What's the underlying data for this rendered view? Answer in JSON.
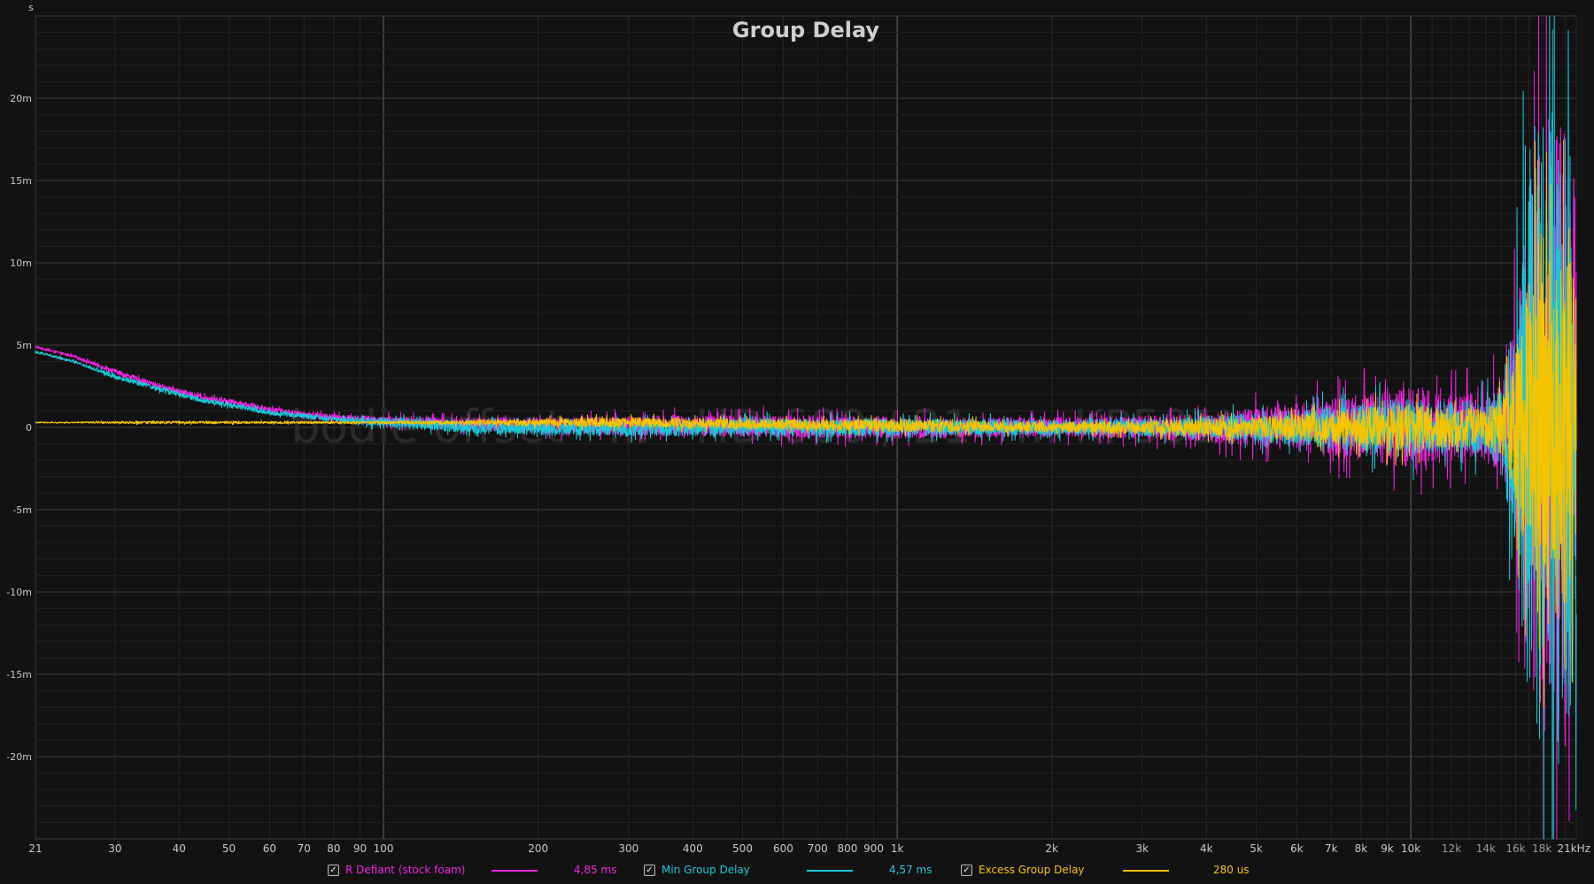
{
  "chart_data": {
    "type": "line",
    "title": "Group Delay",
    "ylabel": "s",
    "xlabel": "",
    "x_scale": "log",
    "xlim": [
      21,
      21000
    ],
    "ylim": [
      -0.025,
      0.025
    ],
    "grid": true,
    "legend_position": "bottom",
    "x_ticks_major": [
      "21",
      "30",
      "40",
      "50",
      "60",
      "70",
      "80",
      "90",
      "100",
      "200",
      "300",
      "400",
      "500",
      "600",
      "700",
      "800",
      "900",
      "1k",
      "2k",
      "3k",
      "4k",
      "5k",
      "6k",
      "7k",
      "8k",
      "9k",
      "10k",
      "21kHz"
    ],
    "x_ticks_minor": [
      "12k",
      "14k",
      "16k",
      "18k"
    ],
    "y_ticks": [
      "20m",
      "15m",
      "10m",
      "5m",
      "0",
      "-5m",
      "-10m",
      "-15m",
      "-20m"
    ],
    "watermark": "bodie offset · ... · HD 600 / 21 · ... KP501X · ...",
    "series": [
      {
        "name": "R Defiant (stock foam)",
        "color": "#ee22dd",
        "legend_value": "4,85 ms",
        "x": [
          21,
          25,
          30,
          35,
          40,
          45,
          50,
          60,
          70,
          80,
          90,
          100,
          150,
          200,
          300,
          500,
          1000,
          2000,
          3000,
          4000,
          5000,
          6000,
          7000,
          8000,
          9000,
          10000,
          12000,
          14000,
          15000,
          16000,
          17000,
          18000,
          19000,
          20000,
          21000
        ],
        "y": [
          0.0049,
          0.0043,
          0.0034,
          0.0027,
          0.0022,
          0.0018,
          0.0016,
          0.0011,
          0.0008,
          0.0006,
          0.0005,
          0.0004,
          0.0002,
          0.0001,
          0.0001,
          0.0001,
          0.0,
          0.0,
          0.0,
          0.0,
          0.0,
          0.0,
          0.0,
          0.0,
          0.0,
          0.0,
          0.0,
          0.0,
          0.0,
          0.0,
          0.0,
          0.0,
          0.0,
          0.0,
          0.0
        ],
        "spread": [
          0.0001,
          0.0001,
          0.0002,
          0.0002,
          0.0002,
          0.0002,
          0.0002,
          0.0002,
          0.0002,
          0.0003,
          0.0003,
          0.0004,
          0.0005,
          0.0006,
          0.0008,
          0.0009,
          0.0009,
          0.0008,
          0.0009,
          0.0012,
          0.0016,
          0.0019,
          0.0023,
          0.0027,
          0.003,
          0.0034,
          0.0028,
          0.0028,
          0.004,
          0.009,
          0.02,
          0.026,
          0.026,
          0.024,
          0.02
        ]
      },
      {
        "name": "Min Group Delay",
        "color": "#17c9d6",
        "legend_value": "4,57 ms",
        "x": [
          21,
          25,
          30,
          35,
          40,
          45,
          50,
          60,
          70,
          80,
          90,
          100,
          150,
          200,
          300,
          500,
          1000,
          2000,
          3000,
          4000,
          5000,
          6000,
          7000,
          8000,
          9000,
          10000,
          12000,
          14000,
          15000,
          16000,
          17000,
          18000,
          19000,
          20000,
          21000
        ],
        "y": [
          0.0046,
          0.004,
          0.0031,
          0.0025,
          0.002,
          0.0016,
          0.0014,
          0.0009,
          0.0007,
          0.0005,
          0.0004,
          0.0003,
          0.0,
          -0.0001,
          -0.0001,
          0.0,
          0.0,
          0.0,
          0.0,
          0.0,
          0.0,
          0.0,
          0.0,
          0.0,
          0.0,
          0.0,
          0.0,
          0.0,
          0.0,
          0.0,
          0.0,
          0.0,
          0.0,
          0.0,
          0.0
        ],
        "spread": [
          0.0001,
          0.0001,
          0.0002,
          0.0002,
          0.0002,
          0.0002,
          0.0002,
          0.0002,
          0.0002,
          0.0002,
          0.0003,
          0.0004,
          0.0005,
          0.0005,
          0.0006,
          0.0007,
          0.0007,
          0.0006,
          0.0007,
          0.0009,
          0.0012,
          0.0014,
          0.0017,
          0.002,
          0.0022,
          0.0024,
          0.0021,
          0.0022,
          0.0035,
          0.01,
          0.024,
          0.026,
          0.026,
          0.025,
          0.02
        ]
      },
      {
        "name": "Excess Group Delay",
        "color": "#f5c400",
        "legend_value": "280 us",
        "x": [
          21,
          25,
          30,
          35,
          40,
          45,
          50,
          60,
          70,
          80,
          90,
          100,
          150,
          200,
          300,
          500,
          1000,
          2000,
          3000,
          4000,
          5000,
          6000,
          7000,
          8000,
          9000,
          10000,
          12000,
          14000,
          15000,
          16000,
          17000,
          18000,
          19000,
          20000,
          21000
        ],
        "y": [
          0.0003,
          0.0003,
          0.0003,
          0.0003,
          0.0003,
          0.0003,
          0.0003,
          0.0003,
          0.0003,
          0.0003,
          0.0003,
          0.0003,
          0.0003,
          0.0003,
          0.0003,
          0.0002,
          0.0001,
          0.0,
          0.0,
          0.0,
          0.0,
          0.0,
          0.0,
          0.0,
          0.0,
          0.0,
          0.0,
          0.0,
          0.0,
          0.0,
          0.0,
          0.0,
          0.0,
          0.0,
          0.0
        ],
        "spread": [
          5e-05,
          5e-05,
          8e-05,
          0.0001,
          0.0001,
          0.0001,
          0.0001,
          0.0001,
          0.0001,
          0.0001,
          0.0001,
          0.0001,
          0.0002,
          0.0003,
          0.0004,
          0.0004,
          0.0005,
          0.0004,
          0.0005,
          0.0007,
          0.0009,
          0.0011,
          0.0013,
          0.0015,
          0.0017,
          0.0019,
          0.0016,
          0.0015,
          0.0022,
          0.006,
          0.012,
          0.016,
          0.016,
          0.015,
          0.013
        ]
      }
    ]
  },
  "legend": {
    "items": [
      {
        "label": "R Defiant (stock foam)",
        "value": "4,85 ms",
        "checked": "✓"
      },
      {
        "label": "Min Group Delay",
        "value": "4,57 ms",
        "checked": "✓"
      },
      {
        "label": "Excess Group Delay",
        "value": "280 us",
        "checked": "✓"
      }
    ]
  }
}
